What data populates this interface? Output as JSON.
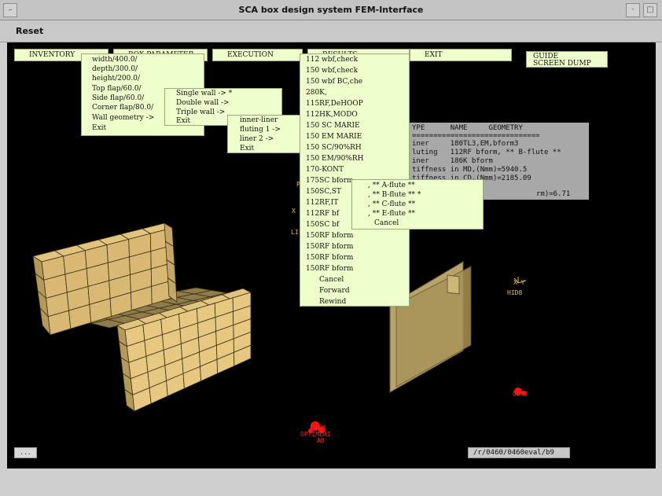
{
  "window": {
    "title": "SCA box design system FEM-Interface"
  },
  "menubar": {
    "reset_label": "Reset"
  },
  "toolbar": {
    "inventory": "INVENTORY",
    "box_parameter": "BOX PARAMETER",
    "execution": "EXECUTION",
    "results": "RESULTS",
    "exit": "EXIT"
  },
  "guide_box": {
    "guide": "GUIDE",
    "screen_dump": "SCREEN DUMP"
  },
  "box_param_menu": [
    "width/400.0/",
    "depth/300.0/",
    "height/200.0/",
    "Top flap/60.0/",
    "Side flap/60.0/",
    "Corner flap/80.0/",
    "Wall geometry ->",
    "Exit"
  ],
  "wall_menu": [
    "Single wall -> *",
    "Double wall ->",
    "Triple wall ->",
    "Exit"
  ],
  "liner_menu": [
    "inner-liner",
    "fluting  1 ->",
    "liner   2 ->",
    "Exit"
  ],
  "results_menu": [
    "112 wbf,check",
    "150 wbf,check",
    "150 wbf BC,che",
    "280K,",
    "115RF,DeHOOP",
    "112HK,MODO",
    "150 SC MARIE",
    "150 EM MARIE",
    "150 SC/90%RH",
    "150 EM/90%RH",
    "170-KONT",
    "175SC bform",
    "150SC,ST",
    "112RF,IT",
    "112RF bf",
    "150SC bf",
    "150RF bform",
    "150RF bform",
    "150RF bform",
    "150RF bform",
    "Cancel",
    "Forward",
    "Rewind"
  ],
  "flute_menu": [
    ", ** A-flute **",
    ", ** B-flute ** *",
    ", ** C-flute **",
    ", ** E-flute **",
    "Cancel"
  ],
  "info_panel": {
    "header": "YPE      NAME     GEOMETRY",
    "separator": "==============================",
    "lines": [
      "iner     180TL3,EM,bform3",
      "luting   112RF bform, ** B-flute **",
      "iner     186K bform",
      "tiffness in MD,(Nmm)=5940.5",
      "tiffness in CD,(Nmm)=2185.09",
      "",
      "rm)=6.71"
    ]
  },
  "scene_labels": {
    "p_label": "P",
    "x_label": "X",
    "li_label": "LI",
    "axis_xy": "X Y",
    "hid8": "HID8",
    "opti": "OPTI",
    "optimize_label_1": "FOAM",
    "optimize_label_2": "OPTIMERI",
    "optimize_label_3": "AB"
  },
  "bottom": {
    "dots_button": "...",
    "path_text": "/r/0460/0460eval/b9"
  },
  "colors": {
    "menu_bg": "#eeffcc",
    "canvas_bg": "#000000",
    "box_face": "#e3c47e",
    "panel_face": "#b8a36a",
    "label_yellow": "#e0c040",
    "label_red": "#ff2020"
  }
}
